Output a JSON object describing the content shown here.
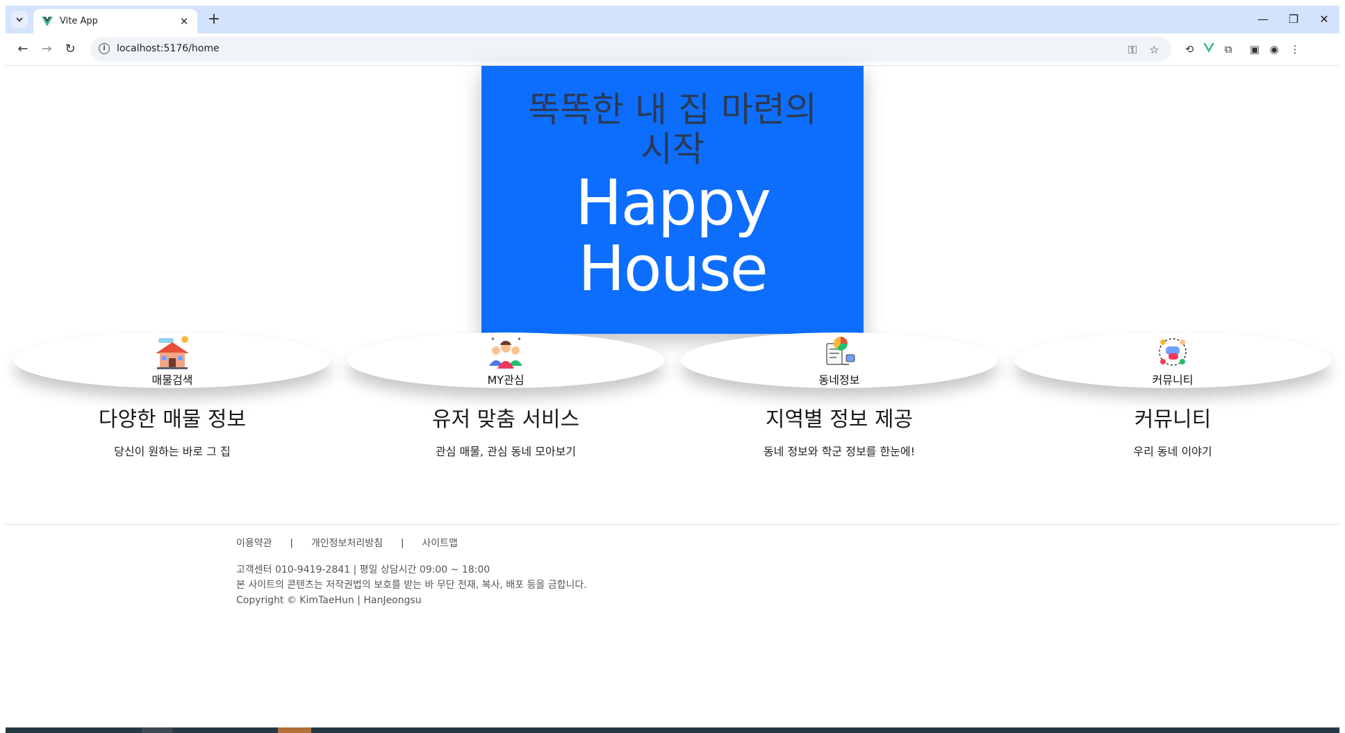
{
  "browser": {
    "tab_title": "Vite App",
    "url": "localhost:5176/home"
  },
  "hero": {
    "tagline": "똑똑한 내 집 마련의 시작",
    "brand": "Happy House"
  },
  "features": [
    {
      "label": "매물검색",
      "title": "다양한 매물 정보",
      "desc": "당신이 원하는 바로 그 집",
      "icon": "house-icon"
    },
    {
      "label": "MY관심",
      "title": "유저 맞춤 서비스",
      "desc": "관심 매물, 관심 동네 모아보기",
      "icon": "users-icon"
    },
    {
      "label": "동네정보",
      "title": "지역별 정보 제공",
      "desc": "동네 정보와 학군 정보를 한눈에!",
      "icon": "report-icon"
    },
    {
      "label": "커뮤니티",
      "title": "커뮤니티",
      "desc": "우리 동네 이야기",
      "icon": "community-icon"
    }
  ],
  "footer": {
    "links": [
      "이용약관",
      "개인정보처리방침",
      "사이트맵"
    ],
    "separator": "|",
    "contact": "고객센터 010-9419-2841 | 평일 상담시간 09:00 ~ 18:00",
    "notice": "본 사이트의 콘텐츠는 저작권법의 보호를 받는 바 무단 전재, 복사, 배포 등을 금합니다.",
    "copyright": "Copyright © KimTaeHun | HanJeongsu"
  },
  "colors": {
    "hero_bg": "#0d6efd",
    "tagline": "#2a3a55",
    "tabstrip": "#d3e3fd"
  }
}
